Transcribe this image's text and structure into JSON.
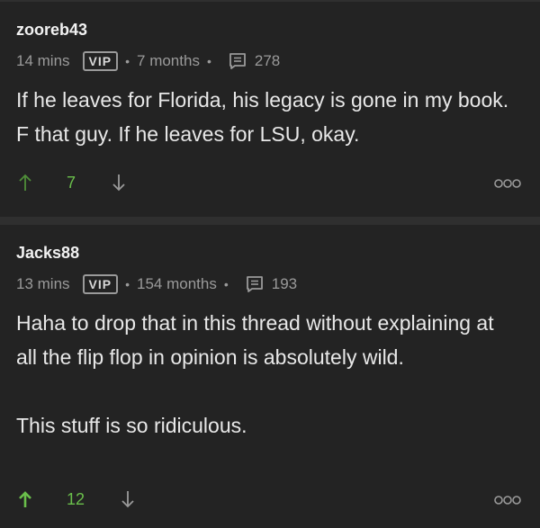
{
  "comments": [
    {
      "username": "zooreb43",
      "posted": "14 mins",
      "badge": "VIP",
      "tenure": "7 months",
      "post_count": "278",
      "body": [
        "If he leaves for Florida, his legacy is gone in my book. F that guy. If he leaves for LSU, okay."
      ],
      "score": "7",
      "upvoted": false
    },
    {
      "username": "Jacks88",
      "posted": "13 mins",
      "badge": "VIP",
      "tenure": "154 months",
      "post_count": "193",
      "body": [
        "Haha to drop that in this thread without explaining at all the flip flop in opinion is absolutely wild.",
        "This stuff is so ridiculous."
      ],
      "score": "12",
      "upvoted": true
    }
  ],
  "icons": {
    "upvote": "arrow-up-icon",
    "downvote": "arrow-down-icon",
    "posts": "chat-icon",
    "more": "more-options-icon"
  },
  "colors": {
    "background": "#232323",
    "separator": "#2f2f2f",
    "score": "#6abf4b",
    "upvote_inactive": "#4f8e38",
    "upvote_active": "#6abf4b",
    "muted": "#9a9a9a"
  },
  "separator_dot": "•"
}
